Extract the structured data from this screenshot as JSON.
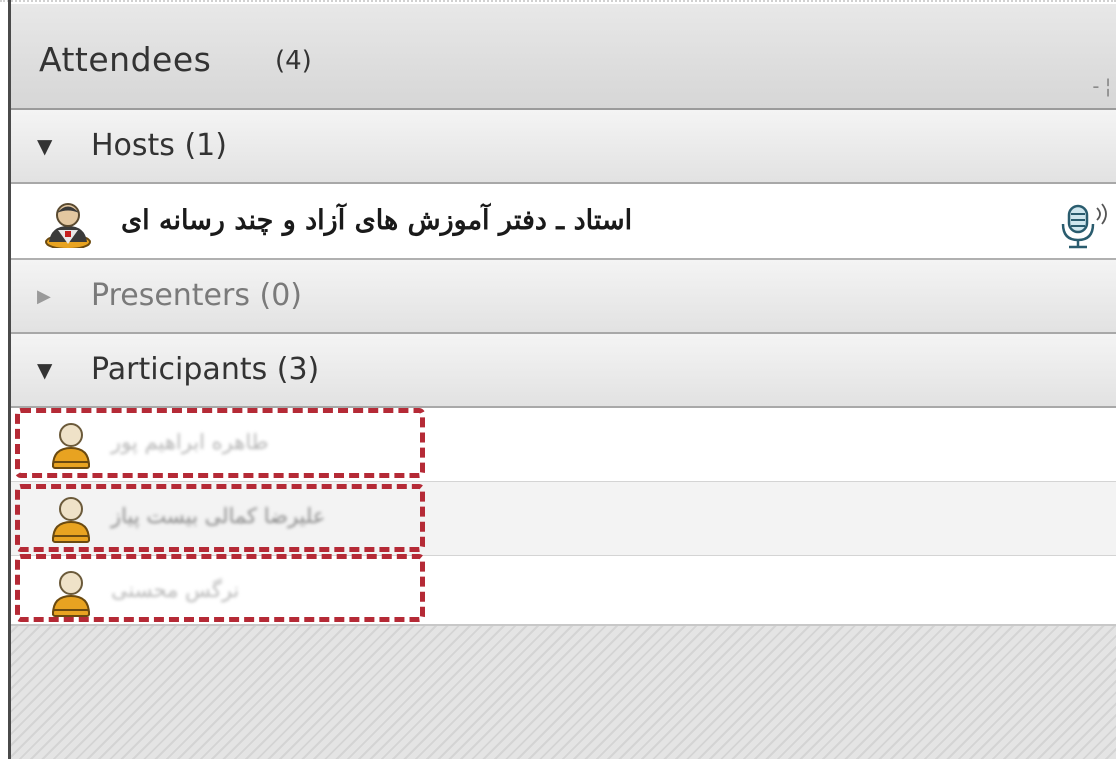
{
  "header": {
    "title": "Attendees",
    "count": "(4)"
  },
  "sections": {
    "hosts": {
      "label": "Hosts (1)",
      "expanded": true
    },
    "presenters": {
      "label": "Presenters (0)",
      "expanded": false
    },
    "participants": {
      "label": "Participants (3)",
      "expanded": true
    }
  },
  "host": {
    "name": "استاد ـ دفتر آموزش های آزاد و چند رسانه ای",
    "icon": "host-avatar-icon",
    "status_icon": "microphone-active-icon"
  },
  "participants": [
    {
      "name": "طاهره ابراهیم پور",
      "icon": "participant-avatar-icon"
    },
    {
      "name": "علیرضا کمالی بیست پیاز",
      "icon": "participant-avatar-icon"
    },
    {
      "name": "نرگس محسنی",
      "icon": "participant-avatar-icon"
    }
  ],
  "colors": {
    "annotation_dash": "#b52a36",
    "header_bg": "#d9d9d9",
    "avatar_orange": "#e8a321"
  }
}
